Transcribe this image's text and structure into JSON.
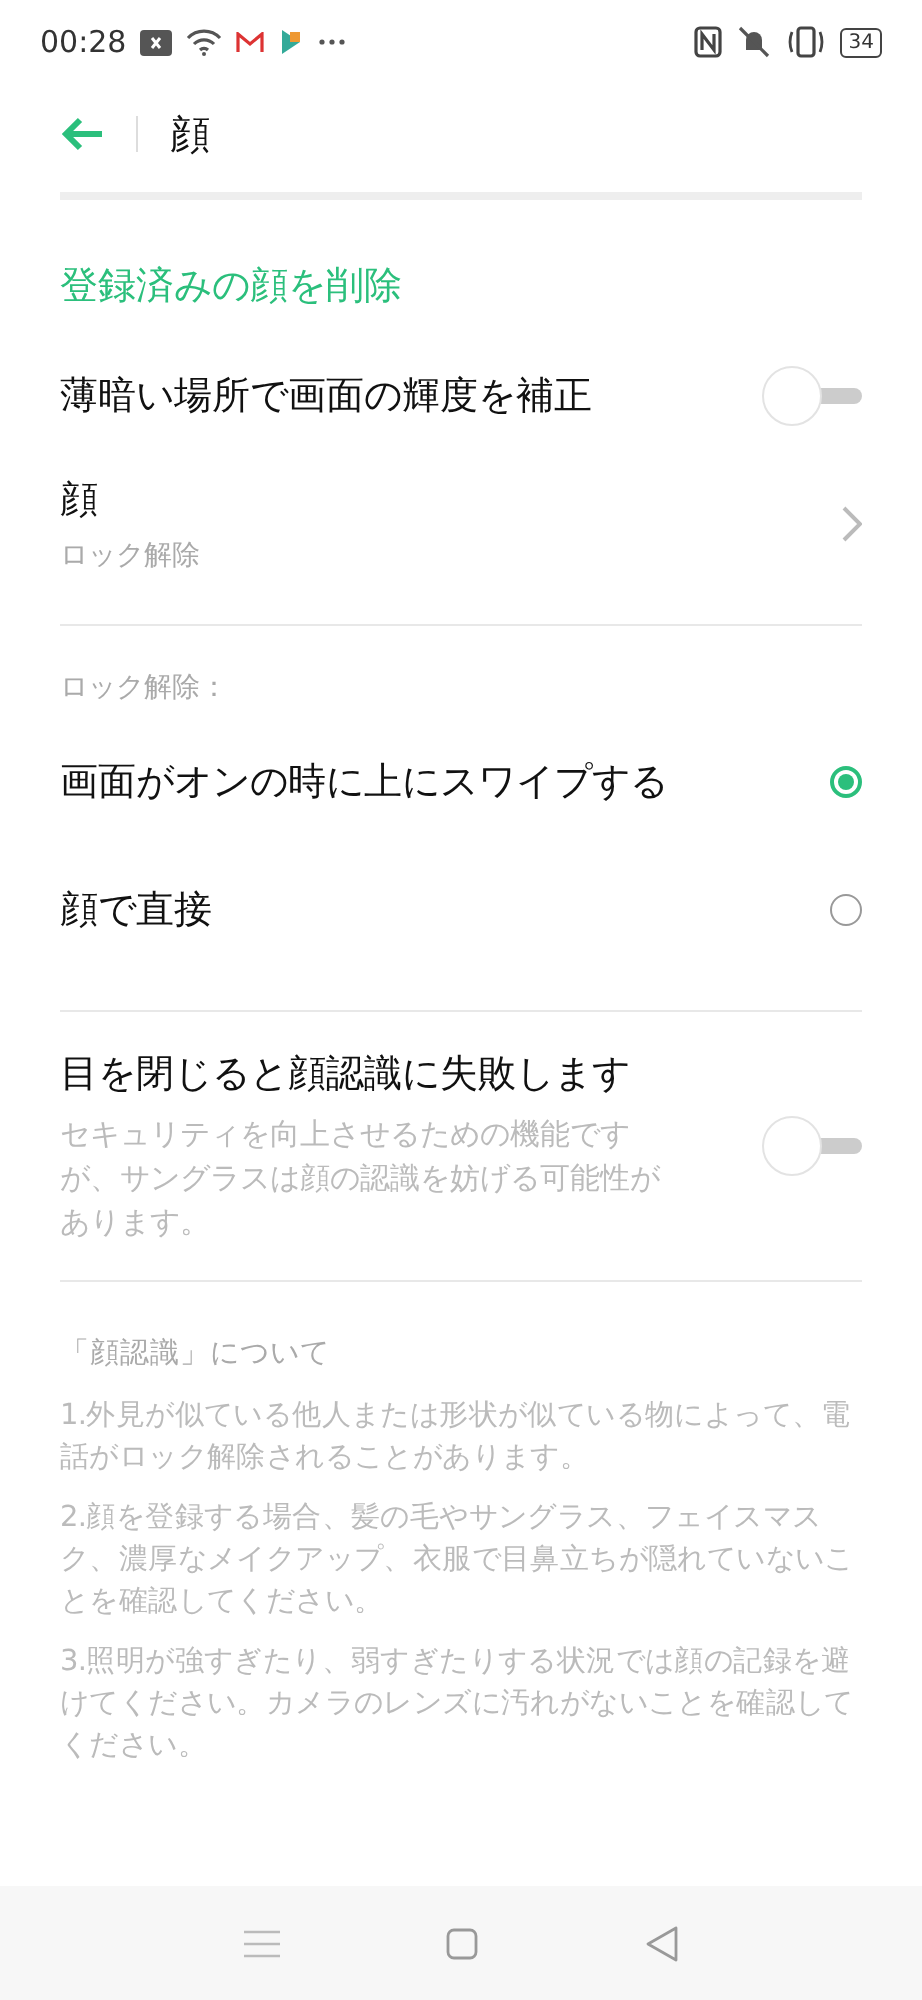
{
  "status_bar": {
    "time": "00:28",
    "battery": "34"
  },
  "header": {
    "title": "顔"
  },
  "delete_link": "登録済みの顔を削除",
  "settings": [
    {
      "kind": "toggle",
      "label": "薄暗い場所で画面の輝度を補正",
      "on": false
    },
    {
      "kind": "link",
      "label": "顔",
      "sublabel": "ロック解除"
    }
  ],
  "unlock": {
    "heading": "ロック解除：",
    "options": [
      {
        "label": "画面がオンの時に上にスワイプする",
        "selected": true
      },
      {
        "label": "顔で直接",
        "selected": false
      }
    ]
  },
  "eyes": {
    "label": "目を閉じると顔認識に失敗します",
    "description": "セキュリティを向上させるための機能ですが、サングラスは顔の認識を妨げる可能性があります。",
    "on": false
  },
  "about": {
    "heading": "「顔認識」について",
    "notes": [
      "1.外見が似ている他人または形状が似ている物によって、電話がロック解除されることがあります。",
      "2.顔を登録する場合、髪の毛やサングラス、フェイスマスク、濃厚なメイクアップ、衣服で目鼻立ちが隠れていないことを確認してください。",
      "3.照明が強すぎたり、弱すぎたりする状況では顔の記録を避けてください。カメラのレンズに汚れがないことを確認してください。"
    ]
  }
}
